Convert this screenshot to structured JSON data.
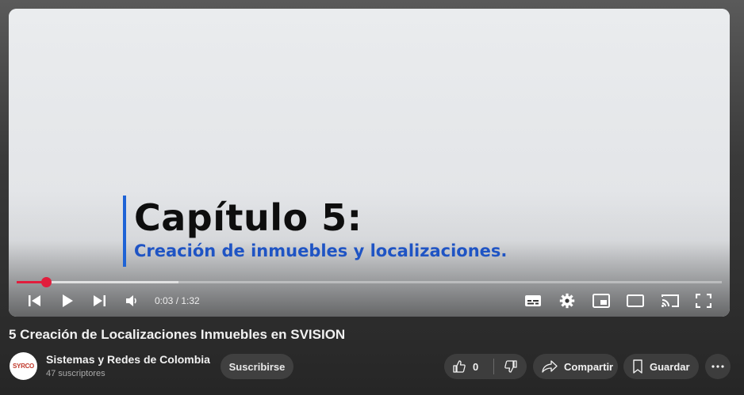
{
  "player": {
    "chapter_title": "Capítulo 5:",
    "chapter_subtitle": "Creación de inmuebles y localizaciones.",
    "time_display": "0:03 / 1:32",
    "progress_fraction": 0.042,
    "buffer_fraction": 0.23,
    "accent_color": "#e11d3c",
    "controls": {
      "previous_icon": "skip-previous-icon",
      "play_icon": "play-icon",
      "next_icon": "skip-next-icon",
      "volume_icon": "volume-icon",
      "subtitles_icon": "subtitles-icon",
      "settings_icon": "gear-icon",
      "miniplayer_icon": "miniplayer-icon",
      "theater_icon": "theater-mode-icon",
      "cast_icon": "cast-icon",
      "fullscreen_icon": "fullscreen-icon"
    }
  },
  "video": {
    "title": "5 Creación de Localizaciones Inmuebles en SVISION"
  },
  "channel": {
    "avatar_text": "SYRCO",
    "name": "Sistemas y Redes de Colombia",
    "subscribers": "47 suscriptores",
    "subscribe_label": "Suscribirse"
  },
  "actions": {
    "like_count": "0",
    "share_label": "Compartir",
    "save_label": "Guardar"
  }
}
